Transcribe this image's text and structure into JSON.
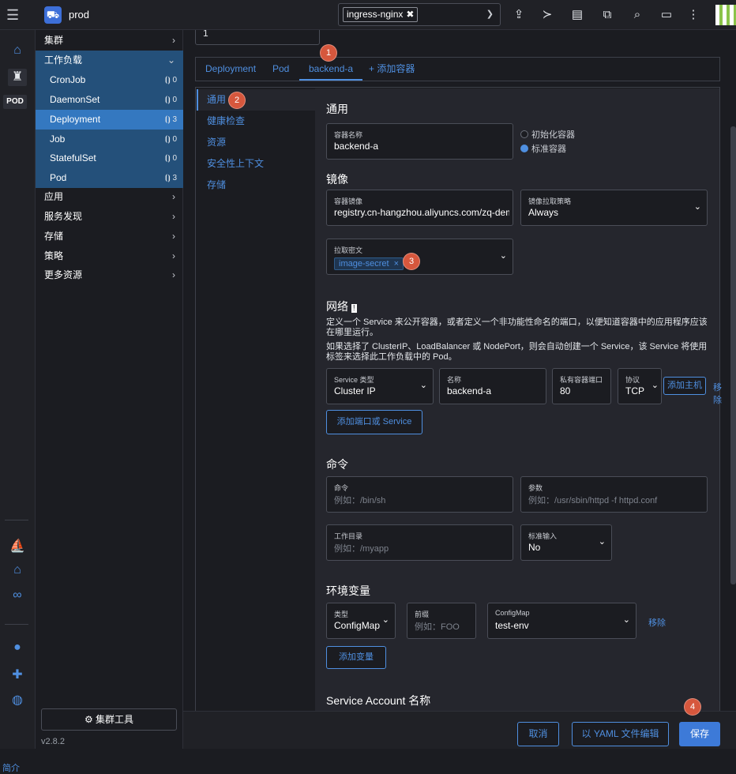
{
  "header": {
    "cluster": "prod",
    "namespace_tag": "ingress-nginx",
    "remove_glyph": "✖"
  },
  "rail": {
    "pod_badge": "POD",
    "about": "简介"
  },
  "nav": {
    "groups_top": [
      {
        "label": "集群"
      },
      {
        "label": "工作负载"
      }
    ],
    "workloads": [
      {
        "label": "CronJob",
        "count": "0"
      },
      {
        "label": "DaemonSet",
        "count": "0"
      },
      {
        "label": "Deployment",
        "count": "3"
      },
      {
        "label": "Job",
        "count": "0"
      },
      {
        "label": "StatefulSet",
        "count": "0"
      },
      {
        "label": "Pod",
        "count": "3"
      }
    ],
    "groups_bottom": [
      {
        "label": "应用"
      },
      {
        "label": "服务发现"
      },
      {
        "label": "存储"
      },
      {
        "label": "策略"
      },
      {
        "label": "更多资源"
      }
    ],
    "tools_button": "⚙ 集群工具",
    "version": "v2.8.2"
  },
  "content": {
    "top_input_value": "1",
    "tabs": [
      "Deployment",
      "Pod",
      "backend-a",
      "+ 添加容器"
    ],
    "sidetabs": [
      "通用",
      "健康检查",
      "资源",
      "安全性上下文",
      "存储"
    ],
    "badges": [
      "1",
      "2",
      "3",
      "4"
    ],
    "general": {
      "title": "通用",
      "container_name_label": "容器名称",
      "container_name_value": "backend-a",
      "radio_init": "初始化容器",
      "radio_standard": "标准容器"
    },
    "image": {
      "title": "镜像",
      "image_label": "容器镜像",
      "image_value": "registry.cn-hangzhou.aliyuncs.com/zq-demo/ngin",
      "pull_policy_label": "镜像拉取策略",
      "pull_policy_value": "Always",
      "pull_secret_label": "拉取密文",
      "pull_secret_tag": "image-secret",
      "remove_glyph": "×"
    },
    "network": {
      "title": "网络",
      "desc1": "定义一个 Service 来公开容器，或者定义一个非功能性命名的端口，以便知道容器中的应用程序应该在哪里运行。",
      "desc2": "如果选择了 ClusterIP、LoadBalancer 或 NodePort，则会自动创建一个 Service，该 Service 将使用标签来选择此工作负载中的 Pod。",
      "service_type_label": "Service 类型",
      "service_type_value": "Cluster IP",
      "name_label": "名称",
      "name_value": "backend-a",
      "port_label": "私有容器端口",
      "port_value": "80",
      "protocol_label": "协议",
      "protocol_value": "TCP",
      "add_host": "添加主机",
      "remove": "移除",
      "add_port": "添加端口或 Service"
    },
    "command": {
      "title": "命令",
      "cmd_label": "命令",
      "cmd_placeholder": "例如：/bin/sh",
      "args_label": "参数",
      "args_placeholder": "例如：/usr/sbin/httpd -f httpd.conf",
      "workdir_label": "工作目录",
      "workdir_placeholder": "例如：/myapp",
      "stdin_label": "标准输入",
      "stdin_value": "No"
    },
    "env": {
      "title": "环境变量",
      "type_label": "类型",
      "type_value": "ConfigMap",
      "prefix_label": "前缀",
      "prefix_placeholder": "例如：FOO",
      "configmap_label": "ConfigMap",
      "configmap_value": "test-env",
      "remove": "移除",
      "add_var": "添加变量"
    },
    "sa": {
      "title": "Service Account 名称"
    }
  },
  "footer": {
    "cancel": "取消",
    "edit_yaml": "以 YAML 文件编辑",
    "save": "保存"
  }
}
